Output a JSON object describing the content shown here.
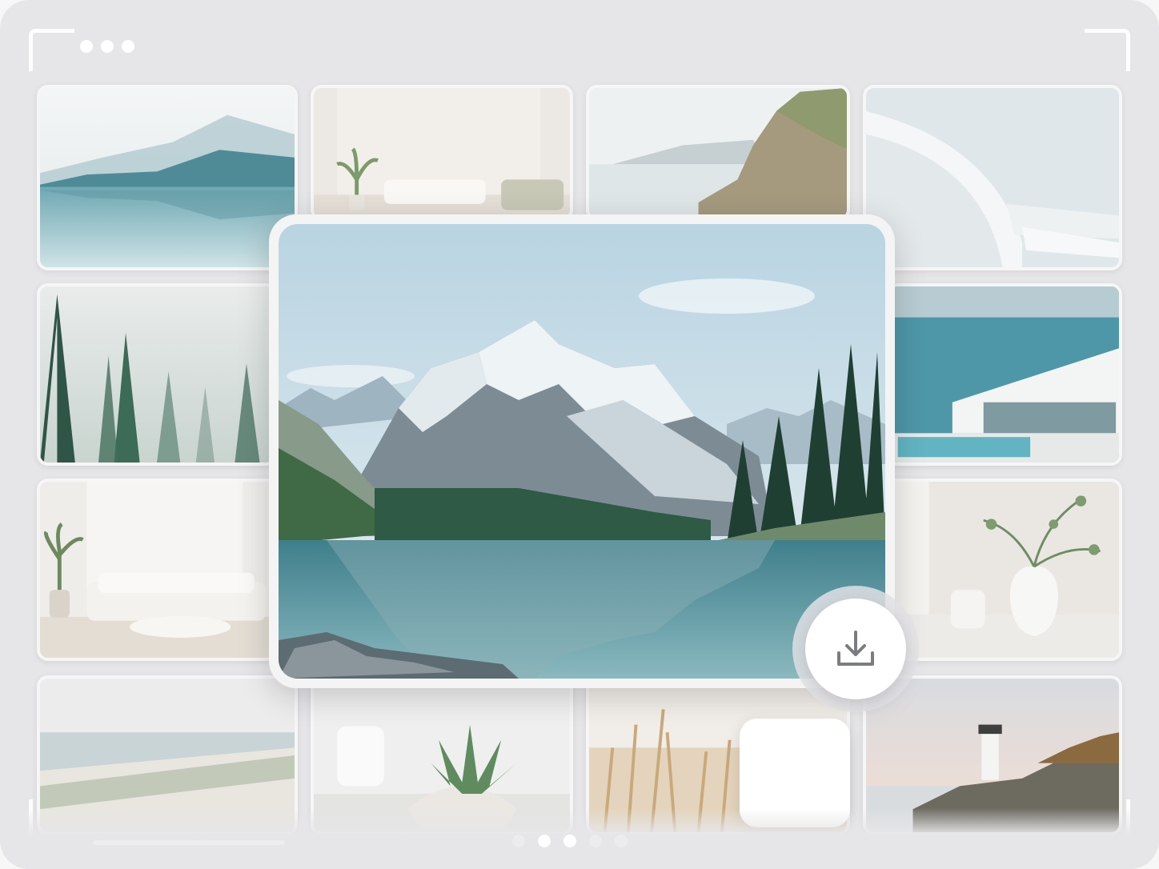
{
  "app": {
    "window_dots": 3,
    "colors": {
      "frame_bg": "#e6e6e8",
      "accent_white": "#ffffff"
    }
  },
  "gallery": {
    "tiles": [
      {
        "subject": "misty-mountain-lake"
      },
      {
        "subject": "white-living-room-with-plant"
      },
      {
        "subject": "coastal-cliff-sea"
      },
      {
        "subject": "white-curved-architecture"
      },
      {
        "subject": "foggy-pine-forest"
      },
      {
        "subject": "seaside-villa-pool"
      },
      {
        "subject": "white-living-room-sofa"
      },
      {
        "subject": "white-vase-with-branches"
      },
      {
        "subject": "misty-beach-shore"
      },
      {
        "subject": "succulent-and-cup"
      },
      {
        "subject": "dry-grass-field"
      },
      {
        "subject": "lighthouse-on-rocks"
      }
    ],
    "featured": {
      "subject": "snowy-mountain-alpine-lake"
    }
  },
  "actions": {
    "download_icon": "download-icon"
  },
  "pagination": {
    "pages": 5,
    "active_index": 1
  }
}
